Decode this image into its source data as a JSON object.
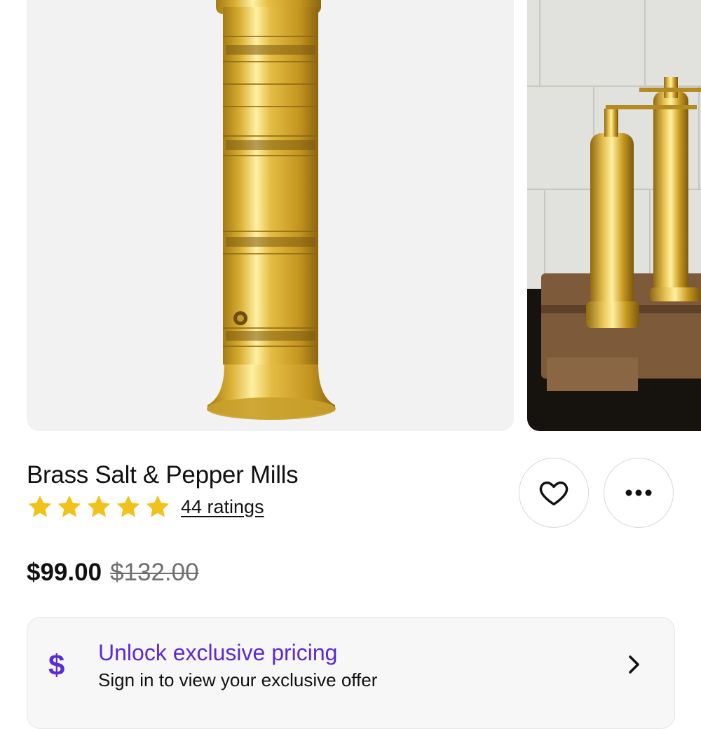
{
  "product": {
    "title": "Brass Salt & Pepper Mills",
    "rating": {
      "stars": 5,
      "count_label": "44 ratings"
    },
    "price": "$99.00",
    "original_price": "$132.00"
  },
  "gallery": {
    "images": [
      {
        "alt": "Brass pepper mill"
      },
      {
        "alt": "Brass salt and pepper mills on wooden board"
      }
    ]
  },
  "actions": {
    "favorite_icon": "heart-icon",
    "more_icon": "more-icon"
  },
  "offer": {
    "icon": "$",
    "title": "Unlock exclusive pricing",
    "subtitle": "Sign in to view your exclusive offer"
  },
  "colors": {
    "accent": "#5b2bd6",
    "star": "#f1c21b",
    "brass": "#d9b23a"
  }
}
